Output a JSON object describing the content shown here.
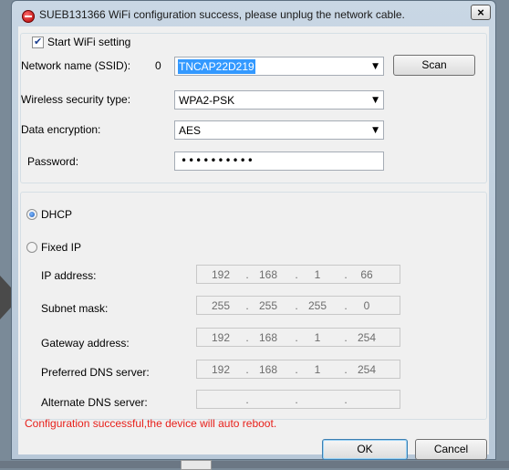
{
  "window": {
    "title": "SUEB131366  WiFi configuration success, please unplug the network cable.",
    "close_label": "×"
  },
  "wifi": {
    "start_label": "Start WiFi setting",
    "start_checked": true,
    "ssid_label": "Network name (SSID):",
    "ssid_index": "0",
    "ssid_value": "TNCAP22D219",
    "scan_label": "Scan",
    "security_label": "Wireless security type:",
    "security_value": "WPA2-PSK",
    "encryption_label": "Data encryption:",
    "encryption_value": "AES",
    "password_label": "Password:",
    "password_value": "••••••••••"
  },
  "network": {
    "dhcp_label": "DHCP",
    "dhcp_selected": true,
    "fixed_label": "Fixed IP",
    "fixed_selected": false,
    "fields": [
      {
        "label": "IP address:",
        "octets": [
          "192",
          "168",
          "1",
          "66"
        ]
      },
      {
        "label": "Subnet mask:",
        "octets": [
          "255",
          "255",
          "255",
          "0"
        ]
      },
      {
        "label": "Gateway address:",
        "octets": [
          "192",
          "168",
          "1",
          "254"
        ]
      },
      {
        "label": "Preferred DNS server:",
        "octets": [
          "192",
          "168",
          "1",
          "254"
        ]
      },
      {
        "label": "Alternate DNS server:",
        "octets": [
          "",
          "",
          "",
          ""
        ]
      }
    ],
    "dot": "."
  },
  "footer": {
    "status": "Configuration successful,the device will auto reboot.",
    "status_color": "#e8201a",
    "ok_label": "OK",
    "cancel_label": "Cancel"
  },
  "icons": {
    "title_icon": "stop-icon",
    "dropdown_icon": "triangle-down-icon"
  }
}
